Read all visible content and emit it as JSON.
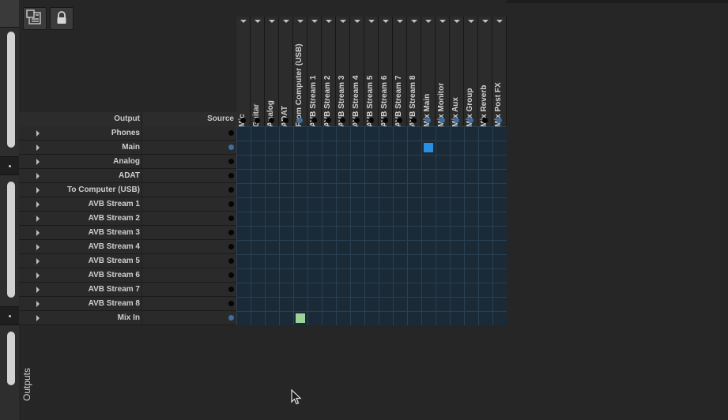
{
  "toolbar": {
    "buttons": [
      {
        "icon": "routing-table-icon"
      },
      {
        "icon": "lock-icon"
      }
    ]
  },
  "sidebar": {
    "tab_label": "Outputs"
  },
  "output_header": {
    "output_label": "Output",
    "source_label": "Source"
  },
  "outputs": [
    {
      "label": "Phones",
      "source_active": false
    },
    {
      "label": "Main",
      "source_active": true
    },
    {
      "label": "Analog",
      "source_active": false
    },
    {
      "label": "ADAT",
      "source_active": false
    },
    {
      "label": "To Computer (USB)",
      "source_active": false
    },
    {
      "label": "AVB Stream 1",
      "source_active": false
    },
    {
      "label": "AVB Stream 2",
      "source_active": false
    },
    {
      "label": "AVB Stream 3",
      "source_active": false
    },
    {
      "label": "AVB Stream 4",
      "source_active": false
    },
    {
      "label": "AVB Stream 5",
      "source_active": false
    },
    {
      "label": "AVB Stream 6",
      "source_active": false
    },
    {
      "label": "AVB Stream 7",
      "source_active": false
    },
    {
      "label": "AVB Stream 8",
      "source_active": false
    },
    {
      "label": "Mix In",
      "source_active": true
    }
  ],
  "sources": [
    {
      "label": "Mic",
      "active": false
    },
    {
      "label": "Guitar",
      "active": false
    },
    {
      "label": "Analog",
      "active": false
    },
    {
      "label": "ADAT",
      "active": false
    },
    {
      "label": "From Computer (USB)",
      "active": true
    },
    {
      "label": "AVB Stream 1",
      "active": false
    },
    {
      "label": "AVB Stream 2",
      "active": false
    },
    {
      "label": "AVB Stream 3",
      "active": false
    },
    {
      "label": "AVB Stream 4",
      "active": false
    },
    {
      "label": "AVB Stream 5",
      "active": false
    },
    {
      "label": "AVB Stream 6",
      "active": false
    },
    {
      "label": "AVB Stream 7",
      "active": false
    },
    {
      "label": "AVB Stream 8",
      "active": false
    },
    {
      "label": "Mix Main",
      "active": true
    },
    {
      "label": "Mix Monitor",
      "active": true
    },
    {
      "label": "Mix Aux",
      "active": true
    },
    {
      "label": "Mix Group",
      "active": true
    },
    {
      "label": "Mix Reverb",
      "active": false
    },
    {
      "label": "Mix Post FX",
      "active": true
    }
  ],
  "routes": [
    {
      "output": "Main",
      "source": "Mix Main",
      "color": "#2a8fe0"
    },
    {
      "output": "Mix In",
      "source": "From Computer (USB)",
      "color": "#9ad29a"
    }
  ],
  "colors": {
    "active_dot": "#3c6f9f",
    "inactive_dot": "#050505",
    "grid_bg": "#1b2a37"
  }
}
